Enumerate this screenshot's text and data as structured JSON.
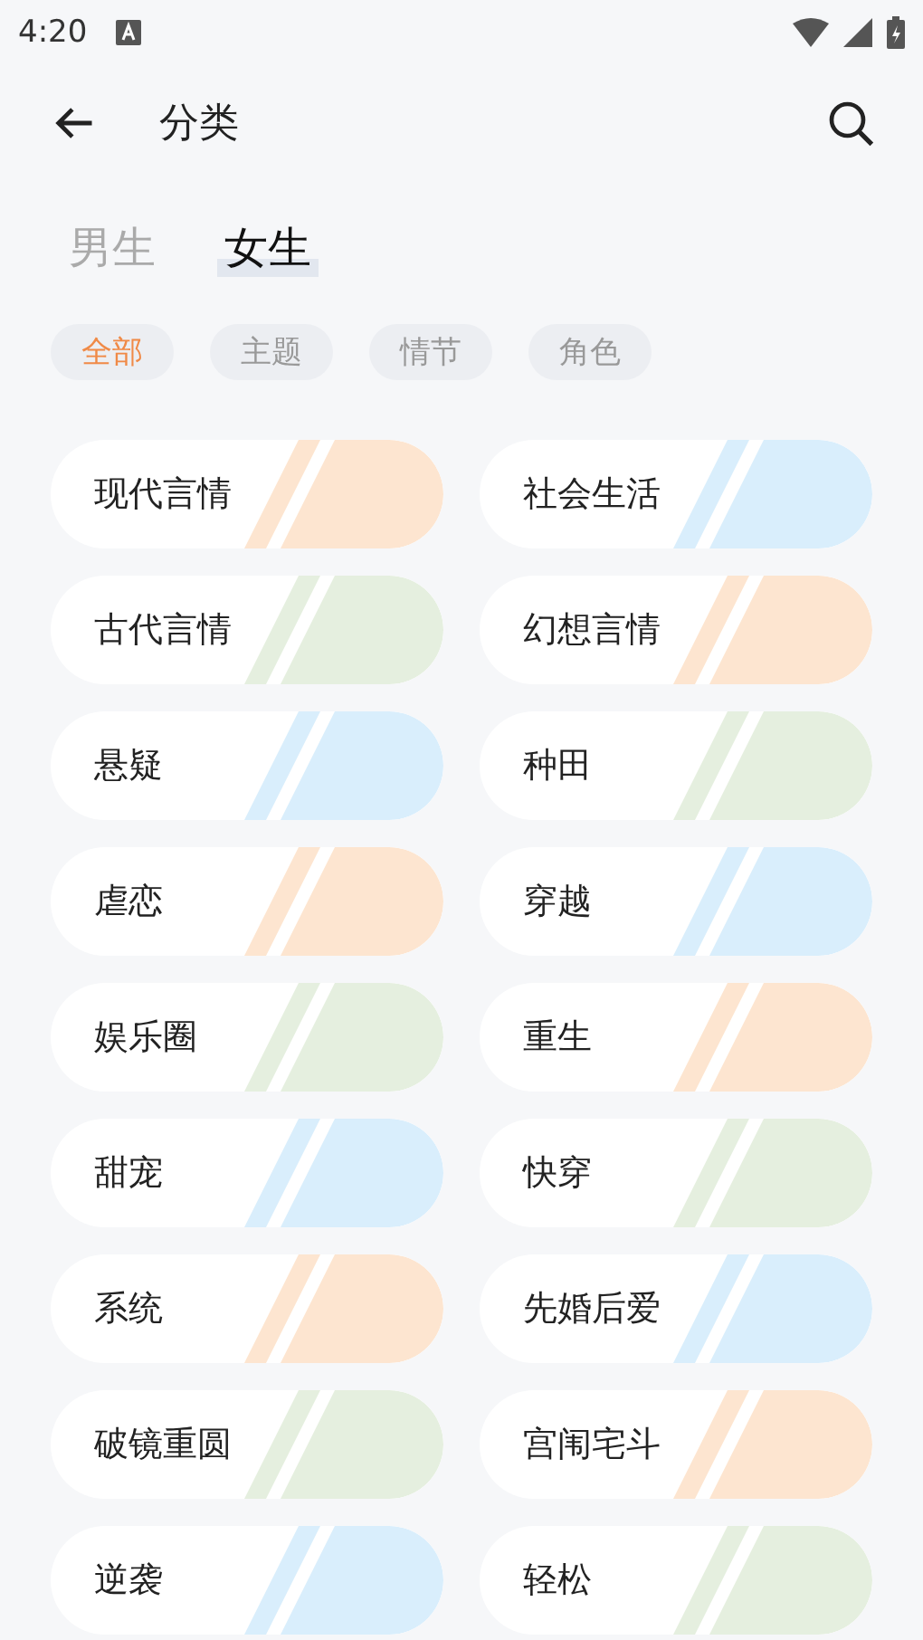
{
  "status_bar": {
    "time": "4:20"
  },
  "header": {
    "title": "分类"
  },
  "tabs": [
    {
      "label": "男生",
      "selected": false
    },
    {
      "label": "女生",
      "selected": true
    }
  ],
  "filters": [
    {
      "label": "全部",
      "selected": true
    },
    {
      "label": "主题",
      "selected": false
    },
    {
      "label": "情节",
      "selected": false
    },
    {
      "label": "角色",
      "selected": false
    }
  ],
  "categories": [
    {
      "label": "现代言情",
      "color": "#fde5d0"
    },
    {
      "label": "社会生活",
      "color": "#d9eefc"
    },
    {
      "label": "古代言情",
      "color": "#e5efdf"
    },
    {
      "label": "幻想言情",
      "color": "#fde5d0"
    },
    {
      "label": "悬疑",
      "color": "#d9eefc"
    },
    {
      "label": "种田",
      "color": "#e5efdf"
    },
    {
      "label": "虐恋",
      "color": "#fde5d0"
    },
    {
      "label": "穿越",
      "color": "#d9eefc"
    },
    {
      "label": "娱乐圈",
      "color": "#e5efdf"
    },
    {
      "label": "重生",
      "color": "#fde5d0"
    },
    {
      "label": "甜宠",
      "color": "#d9eefc"
    },
    {
      "label": "快穿",
      "color": "#e5efdf"
    },
    {
      "label": "系统",
      "color": "#fde5d0"
    },
    {
      "label": "先婚后爱",
      "color": "#d9eefc"
    },
    {
      "label": "破镜重圆",
      "color": "#e5efdf"
    },
    {
      "label": "宫闱宅斗",
      "color": "#fde5d0"
    },
    {
      "label": "逆袭",
      "color": "#d9eefc"
    },
    {
      "label": "轻松",
      "color": "#e5efdf"
    }
  ]
}
